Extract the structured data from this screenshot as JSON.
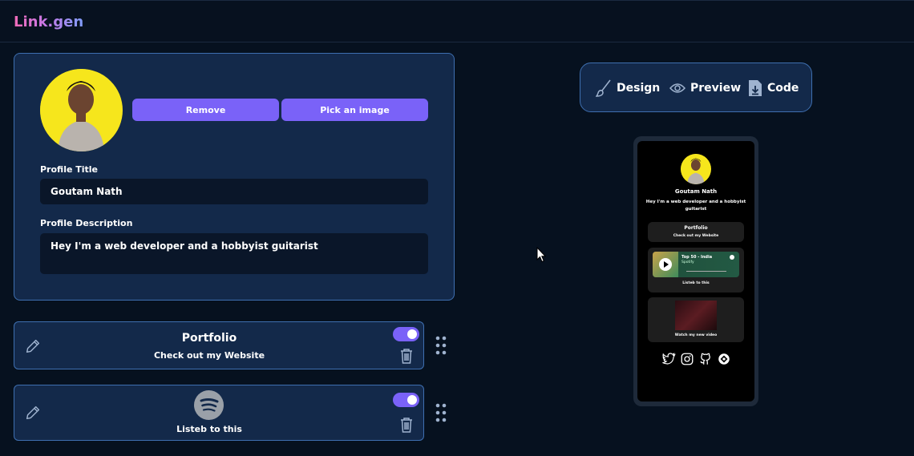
{
  "app": {
    "brand": "Link.gen"
  },
  "profile": {
    "remove_label": "Remove",
    "pick_label": "Pick an image",
    "title_label": "Profile Title",
    "title_value": "Goutam Nath",
    "desc_label": "Profile Description",
    "desc_value": "Hey I'm a web developer and a hobbyist guitarist"
  },
  "links": [
    {
      "title": "Portfolio",
      "subtitle": "Check out my Website",
      "enabled": true,
      "type": "link"
    },
    {
      "title": "",
      "subtitle": "Listeb to this",
      "enabled": true,
      "type": "spotify"
    }
  ],
  "view_tabs": [
    {
      "label": "Design",
      "icon": "brush-icon"
    },
    {
      "label": "Preview",
      "icon": "eye-icon"
    },
    {
      "label": "Code",
      "icon": "file-download-icon"
    }
  ],
  "preview": {
    "name": "Goutam Nath",
    "description": "Hey I'm a web developer and a hobbyist guitarist",
    "cards": [
      {
        "title": "Portfolio",
        "subtitle": "Check out my Website"
      },
      {
        "embed_title": "Top 50 - India",
        "embed_artist": "Spotify",
        "subtitle": "Listeb to this"
      },
      {
        "subtitle": "Watch my new video"
      }
    ],
    "socials": [
      "twitter-icon",
      "instagram-icon",
      "github-icon",
      "other-icon"
    ]
  },
  "colors": {
    "accent": "#7a62f8",
    "card_bg": "#13294a",
    "card_border": "#3e6fb0",
    "page_bg": "#06111f"
  }
}
